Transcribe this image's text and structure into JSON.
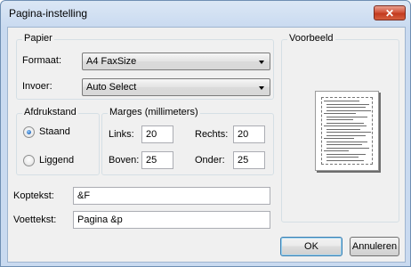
{
  "window": {
    "title": "Pagina-instelling",
    "close_glyph": "✕"
  },
  "paper": {
    "group_label": "Papier",
    "format_label": "Formaat:",
    "format_value": "A4 FaxSize",
    "source_label": "Invoer:",
    "source_value": "Auto Select"
  },
  "orientation": {
    "group_label": "Afdrukstand",
    "portrait_label": "Staand",
    "landscape_label": "Liggend",
    "selected": "portrait"
  },
  "margins": {
    "group_label": "Marges (millimeters)",
    "left_label": "Links:",
    "left_value": "20",
    "right_label": "Rechts:",
    "right_value": "20",
    "top_label": "Boven:",
    "top_value": "25",
    "bottom_label": "Onder:",
    "bottom_value": "25"
  },
  "preview": {
    "group_label": "Voorbeeld"
  },
  "header": {
    "label": "Koptekst:",
    "value": "&F"
  },
  "footer": {
    "label": "Voettekst:",
    "value": "Pagina &p"
  },
  "buttons": {
    "ok": "OK",
    "cancel": "Annuleren"
  },
  "colors": {
    "title_bar": "#c9daf0",
    "close_button": "#c23a1f",
    "dialog_bg": "#f0f0f0"
  }
}
